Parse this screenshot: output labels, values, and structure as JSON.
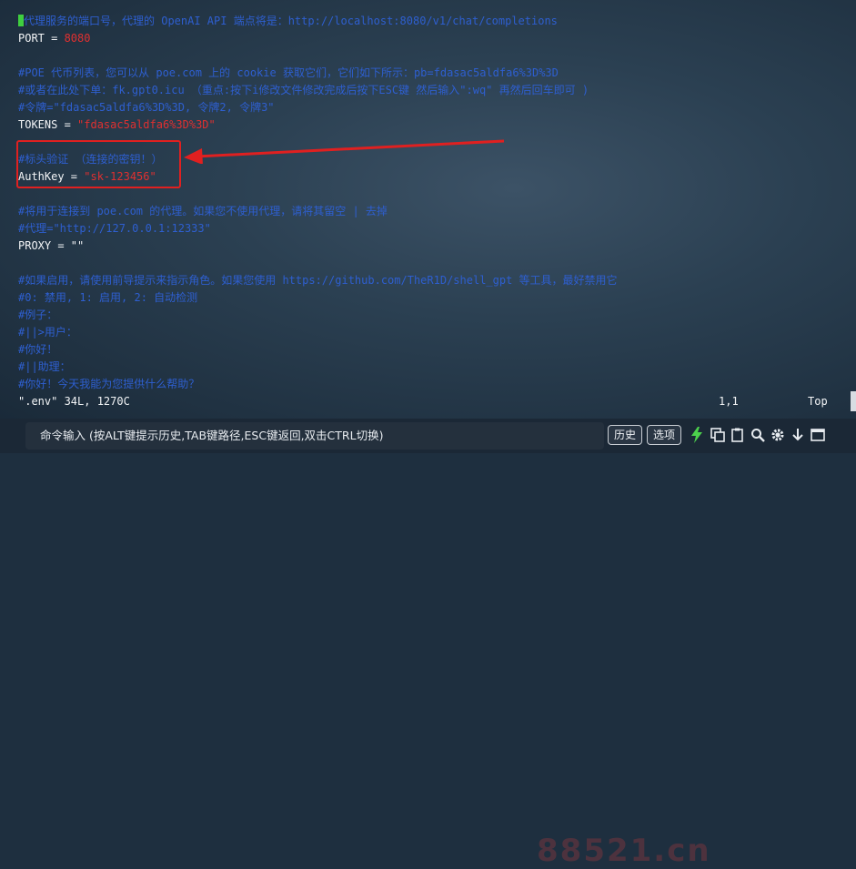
{
  "editor": {
    "lines": [
      {
        "parts": [
          {
            "t": "代理服务的端口号，代理的 OpenAI API 端点将是：http://localhost:8080/v1/chat/completions",
            "k": "c"
          }
        ],
        "cursor": true
      },
      {
        "parts": [
          {
            "t": "PORT = ",
            "k": "p"
          },
          {
            "t": "8080",
            "k": "n"
          }
        ]
      },
      {
        "parts": [
          {
            "t": "#POE 代币列表，您可以从 poe.com 上的 cookie 获取它们，它们如下所示：pb=fdasac5aldfa6%3D%3D",
            "k": "c"
          }
        ]
      },
      {
        "parts": [
          {
            "t": "#或者在此处下单：fk.gpt0.icu （重点:按下i修改文件修改完成后按下ESC键 然后输入\":wq\" 再然后回车即可 )",
            "k": "c"
          }
        ]
      },
      {
        "parts": [
          {
            "t": "#令牌=\"fdasac5aldfa6%3D%3D, 令牌2, 令牌3\"",
            "k": "c"
          }
        ]
      },
      {
        "parts": [
          {
            "t": "TOKENS = ",
            "k": "p"
          },
          {
            "t": "\"fdasac5aldfa6%3D%3D\"",
            "k": "s"
          }
        ]
      },
      {
        "parts": [
          {
            "t": "#标头验证 （连接的密钥！）",
            "k": "c"
          }
        ]
      },
      {
        "parts": [
          {
            "t": "AuthKey = ",
            "k": "p"
          },
          {
            "t": "\"sk-123456\"",
            "k": "s"
          }
        ]
      },
      {
        "parts": [
          {
            "t": "#将用于连接到 poe.com 的代理。如果您不使用代理，请将其留空 | 去掉",
            "k": "c"
          }
        ]
      },
      {
        "parts": [
          {
            "t": "#代理=\"http://127.0.0.1:12333\"",
            "k": "c"
          }
        ]
      },
      {
        "parts": [
          {
            "t": "PROXY = ",
            "k": "p"
          },
          {
            "t": "\"\"",
            "k": "p"
          }
        ]
      },
      {
        "parts": [
          {
            "t": "#如果启用，请使用前导提示来指示角色。如果您使用 https://github.com/TheR1D/shell_gpt 等工具，最好禁用它",
            "k": "c"
          }
        ]
      },
      {
        "parts": [
          {
            "t": "#0: 禁用, 1: 启用, 2: 自动检测",
            "k": "c"
          }
        ]
      },
      {
        "parts": [
          {
            "t": "#例子：",
            "k": "c"
          }
        ]
      },
      {
        "parts": [
          {
            "t": "#||>用户：",
            "k": "c"
          }
        ]
      },
      {
        "parts": [
          {
            "t": "#你好！",
            "k": "c"
          }
        ]
      },
      {
        "parts": [
          {
            "t": "#||助理：",
            "k": "c"
          }
        ]
      },
      {
        "parts": [
          {
            "t": "#你好！今天我能为您提供什么帮助？",
            "k": "c"
          }
        ]
      }
    ],
    "status": {
      "file": "\".env\" 34L, 1270C",
      "position": "1,1",
      "scroll": "Top"
    }
  },
  "cmdbar": {
    "hint": "命令输入 (按ALT键提示历史,TAB键路径,ESC键返回,双击CTRL切换)",
    "history_label": "历史",
    "options_label": "选项"
  },
  "watermark": "88521.cn",
  "colors": {
    "comment": "#2e5fd0",
    "string": "#e03030",
    "annotation": "#e02020",
    "cursor": "#3fcf3f"
  }
}
